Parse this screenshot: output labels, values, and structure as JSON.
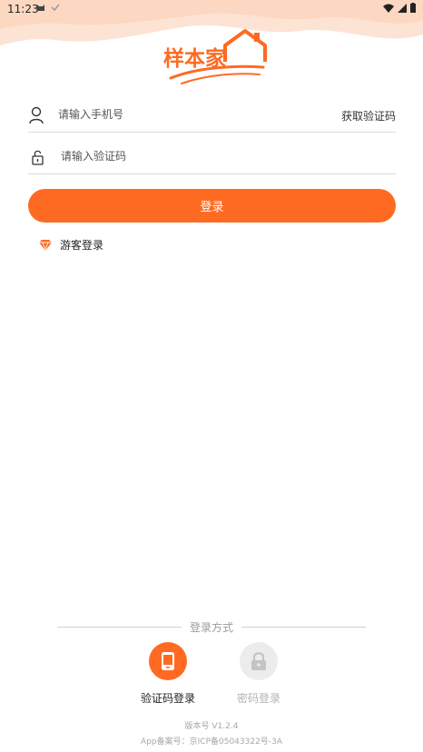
{
  "status_bar": {
    "time": "11:23"
  },
  "brand": {
    "logo_text": "样本家",
    "accent_color": "#ff6a22"
  },
  "login_form": {
    "phone_placeholder": "请输入手机号",
    "get_code_label": "获取验证码",
    "code_placeholder": "请输入验证码",
    "login_button": "登录",
    "guest_login": "游客登录"
  },
  "login_methods": {
    "divider_label": "登录方式",
    "items": [
      {
        "label": "验证码登录",
        "icon": "phone-icon",
        "active": true
      },
      {
        "label": "密码登录",
        "icon": "lock-icon",
        "active": false
      }
    ]
  },
  "footer": {
    "version": "版本号 V1.2.4",
    "icp": "App备案号：京ICP备05043322号-3A"
  }
}
